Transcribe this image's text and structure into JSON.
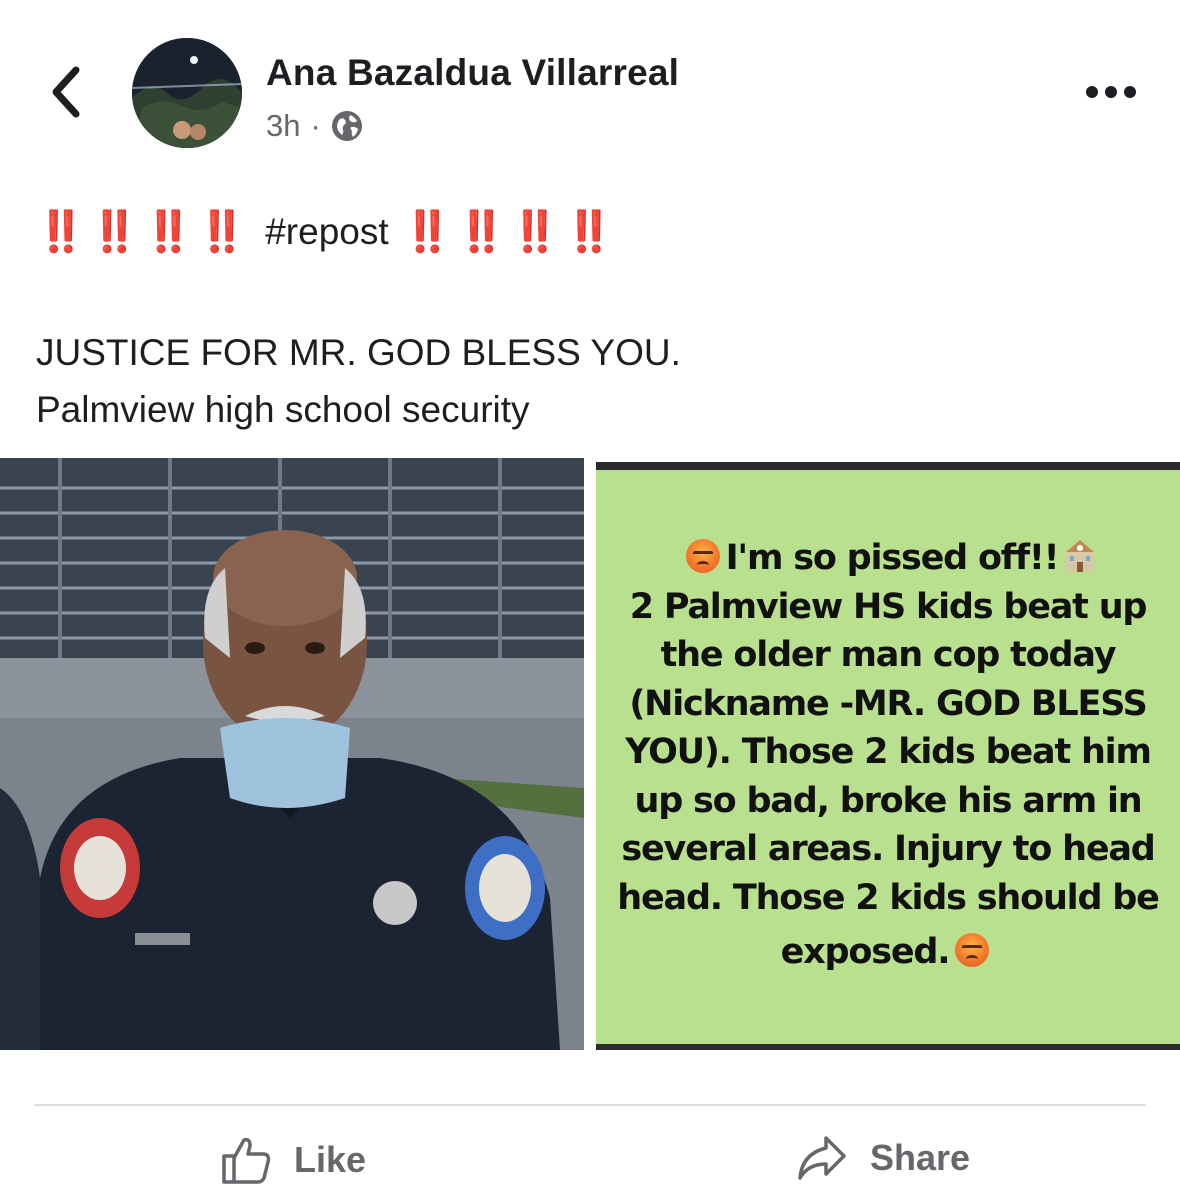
{
  "header": {
    "back_icon": "chevron-left-icon",
    "author": "Ana Bazaldua Villarreal",
    "time": "3h",
    "separator": "·",
    "privacy_icon": "globe-icon",
    "more_icon": "more-horizontal-icon"
  },
  "post": {
    "hashtag": "#repost",
    "emoji_left": "‼️‼️‼️‼️",
    "emoji_right": "‼️‼️‼️‼️",
    "line1": "JUSTICE FOR MR. GOD BLESS YOU.",
    "line2": "Palmview high school security"
  },
  "image_right": {
    "lines": [
      "I'm so pissed off!!",
      "2 Palmview HS kids beat up",
      "the older man cop today",
      "(Nickname -MR. GOD BLESS",
      "YOU). Those 2 kids beat him",
      "up so bad, broke his arm in",
      "several areas. Injury to head",
      "head. Those 2 kids should be",
      "exposed."
    ],
    "background": "#b9e08e"
  },
  "actions": {
    "like": "Like",
    "share": "Share"
  },
  "colors": {
    "accent_red": "#e0281a",
    "secondary_text": "#65676b"
  }
}
